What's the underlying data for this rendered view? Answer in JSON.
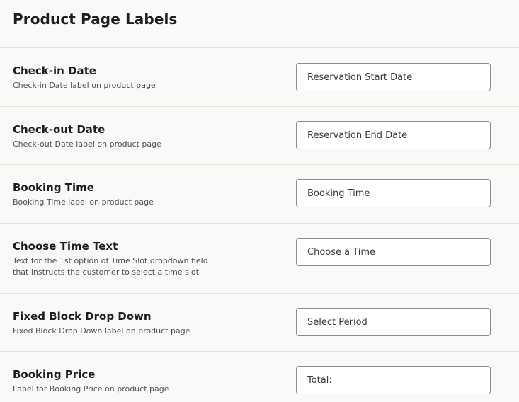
{
  "page": {
    "title": "Product Page Labels"
  },
  "rows": [
    {
      "label": "Check-in Date",
      "description": "Check-in Date label on product page",
      "value": "Reservation Start Date"
    },
    {
      "label": "Check-out Date",
      "description": "Check-out Date label on product page",
      "value": "Reservation End Date"
    },
    {
      "label": "Booking Time",
      "description": "Booking Time label on product page",
      "value": "Booking Time"
    },
    {
      "label": "Choose Time Text",
      "description": "Text for the 1st option of Time Slot dropdown field that instructs the customer to select a time slot",
      "value": "Choose a Time"
    },
    {
      "label": "Fixed Block Drop Down",
      "description": "Fixed Block Drop Down label on product page",
      "value": "Select Period"
    },
    {
      "label": "Booking Price",
      "description": "Label for Booking Price on product page",
      "value": "Total:"
    }
  ]
}
